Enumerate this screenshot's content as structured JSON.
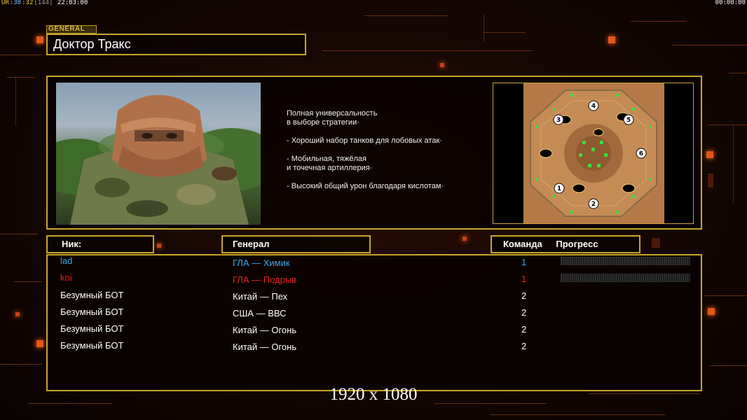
{
  "hud": {
    "left_parts": [
      {
        "text": "UR",
        "color": "#e8d040"
      },
      {
        "text": ":30",
        "color": "#7ecbff"
      },
      {
        "text": ":32",
        "color": "#e8d040"
      },
      {
        "text": "[144]",
        "color": "#9a9a9a"
      },
      {
        "text": " 22:03:00",
        "color": "#ffffff"
      }
    ],
    "right": "00:00:00"
  },
  "general": {
    "tag": "GENERAL",
    "name": "Доктор Тракс",
    "description": [
      "Полная универсальность\nв выборе стратегии·",
      "- Хороший набор танков для лобовых атак·",
      "- Мобильная, тяжёлая\nи точечная артиллерия·",
      "- Высокий общий урон благодаря кислотам·"
    ]
  },
  "map": {
    "slots": [
      "1",
      "2",
      "3",
      "4",
      "5",
      "6"
    ]
  },
  "table": {
    "headers": {
      "nick": "Ник:",
      "general": "Генерал",
      "team": "Команда",
      "progress": "Прогресс"
    },
    "rows": [
      {
        "nick": "lad",
        "general": "ГЛА — Химик",
        "team": "1",
        "color": "#3aa6e8",
        "progress": true
      },
      {
        "nick": "koi",
        "general": "ГЛА — Подрыв",
        "team": "1",
        "color": "#e82020",
        "progress": true
      },
      {
        "nick": "Безумный БОТ",
        "general": "Китай — Пех",
        "team": "2",
        "color": "#ffffff",
        "progress": false
      },
      {
        "nick": "Безумный БОТ",
        "general": "США — ВВС",
        "team": "2",
        "color": "#ffffff",
        "progress": false
      },
      {
        "nick": "Безумный БОТ",
        "general": "Китай — Огонь",
        "team": "2",
        "color": "#ffffff",
        "progress": false
      },
      {
        "nick": "Безумный БОТ",
        "general": "Китай — Огонь",
        "team": "2",
        "color": "#ffffff",
        "progress": false
      }
    ]
  },
  "resolution": "1920 x 1080",
  "colors": {
    "accent": "#c9a52b",
    "background": "#170703"
  }
}
